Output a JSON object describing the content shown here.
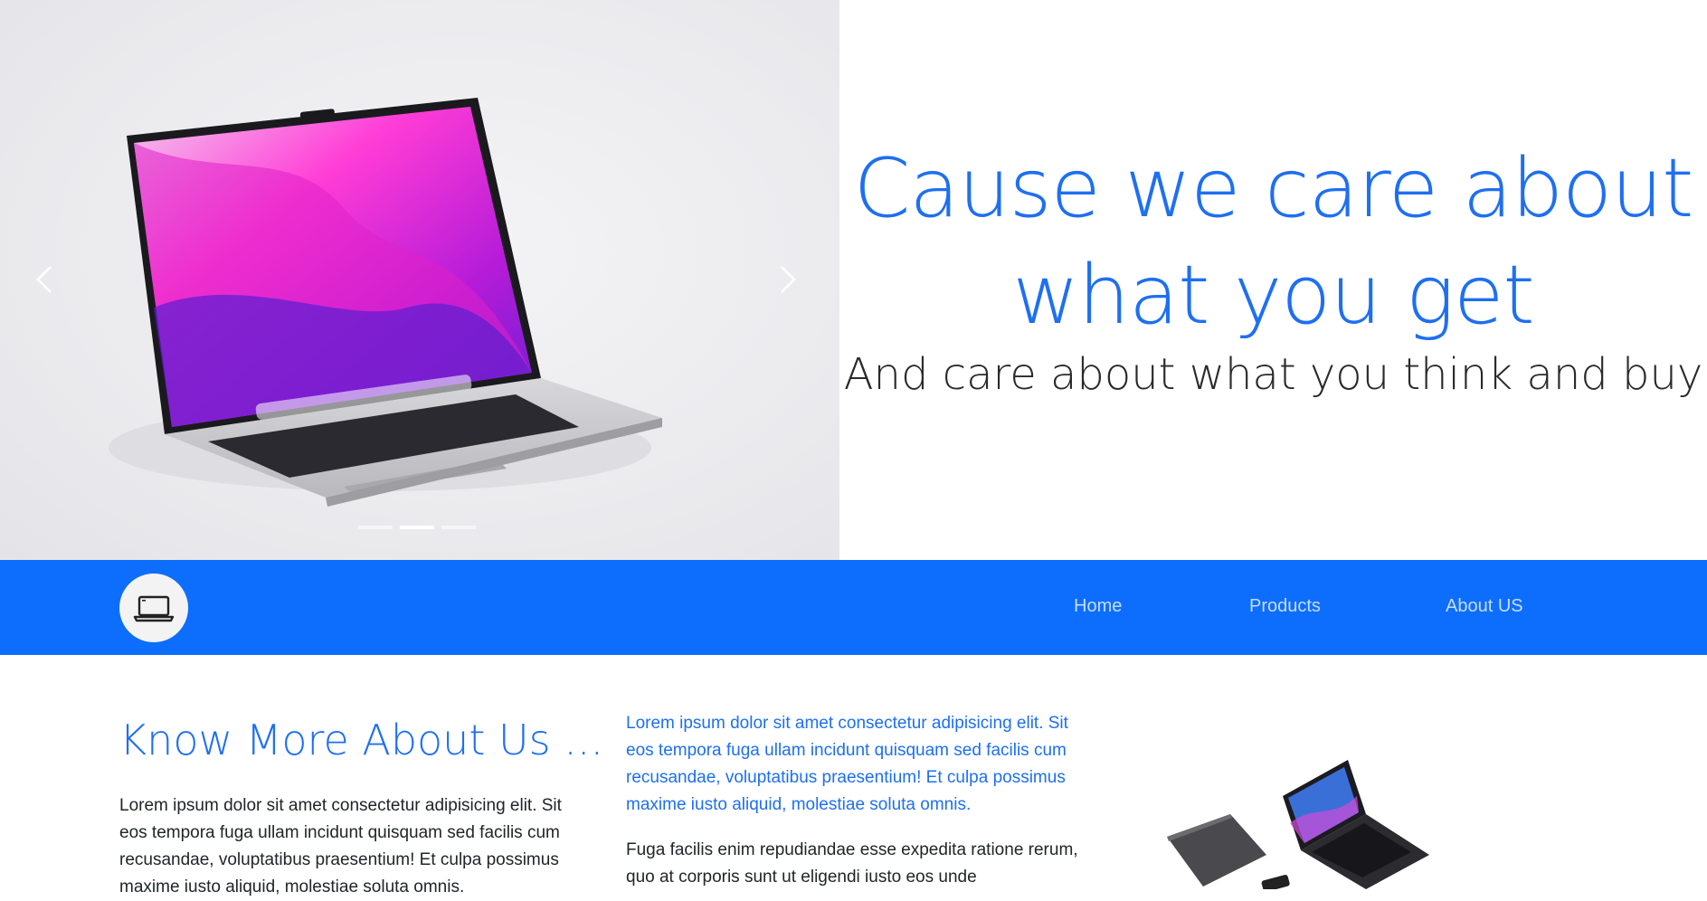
{
  "hero": {
    "title_line1": "Cause we care about",
    "title_line2": "what you get",
    "subtitle": "And care about what you think and buy",
    "carousel": {
      "slide_count": 3,
      "active_index": 1,
      "prev_icon": "chevron-left-icon",
      "next_icon": "chevron-right-icon",
      "image_subject": "laptop"
    }
  },
  "navbar": {
    "brand_icon": "laptop-icon",
    "background_color": "#0d6efd",
    "items": [
      {
        "label": "Home"
      },
      {
        "label": "Products"
      },
      {
        "label": "About US"
      }
    ]
  },
  "about": {
    "heading": "Know More About Us ...",
    "col1_paragraph": "Lorem ipsum dolor sit amet consectetur adipisicing elit. Sit eos tempora fuga ullam incidunt quisquam sed facilis cum recusandae, voluptatibus praesentium! Et culpa possimus maxime iusto aliquid, molestiae soluta omnis.",
    "col2_paragraph1": "Lorem ipsum dolor sit amet consectetur adipisicing elit. Sit eos tempora fuga ullam incidunt quisquam sed facilis cum recusandae, voluptatibus praesentium! Et culpa possimus maxime iusto aliquid, molestiae soluta omnis.",
    "col2_paragraph2": "Fuga facilis enim repudiandae esse expedita ratione rerum, quo at corporis sunt ut eligendi iusto eos unde"
  },
  "colors": {
    "accent_blue": "#1e6ff2",
    "navbar_blue": "#0d6efd",
    "text_dark": "#212529"
  }
}
